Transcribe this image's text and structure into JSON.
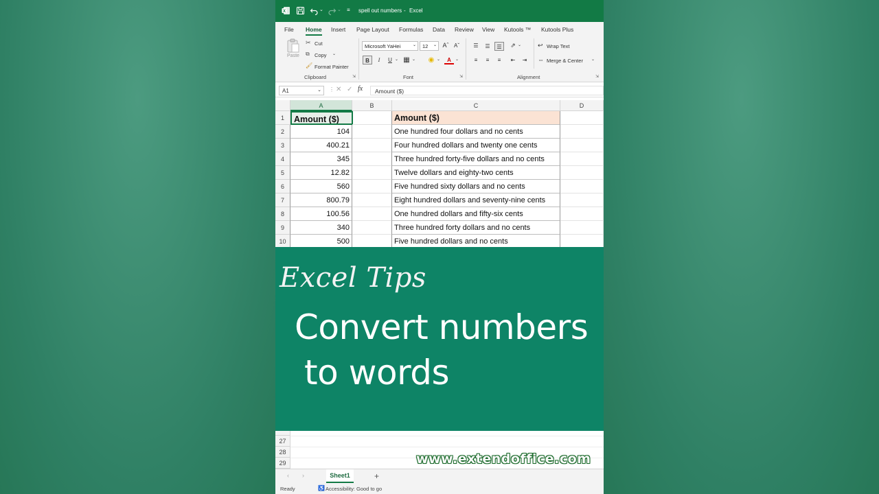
{
  "titlebar": {
    "doc_title": "spell out numbers",
    "app_name": "Excel",
    "separator": "-"
  },
  "menu": [
    "File",
    "Home",
    "Insert",
    "Page Layout",
    "Formulas",
    "Data",
    "Review",
    "View",
    "Kutools ™",
    "Kutools Plus"
  ],
  "ribbon": {
    "paste": "Paste",
    "cut": "Cut",
    "copy": "Copy",
    "format_painter": "Format Painter",
    "clipboard": "Clipboard",
    "font_name": "Microsoft YaHei",
    "font_size": "12",
    "font": "Font",
    "wrap_text": "Wrap Text",
    "merge_center": "Merge & Center",
    "alignment": "Alignment"
  },
  "formula_bar": {
    "name_box": "A1",
    "content": "Amount  ($)"
  },
  "grid": {
    "columns": [
      "A",
      "B",
      "C",
      "D"
    ],
    "rows": [
      "1",
      "2",
      "3",
      "4",
      "5",
      "6",
      "7",
      "8",
      "9",
      "10"
    ],
    "header_a": "Amount  ($)",
    "header_c": "Amount  ($)",
    "amounts": [
      "104",
      "400.21",
      "345",
      "12.82",
      "560",
      "800.79",
      "100.56",
      "340",
      "500"
    ],
    "words": [
      "One hundred four dollars and no cents",
      "Four hundred dollars and twenty one cents",
      "Three hundred forty-five dollars and no cents",
      "Twelve dollars and eighty-two cents",
      "Five hundred sixty dollars and no cents",
      "Eight hundred dollars and seventy-nine cents",
      "One hundred dollars and fifty-six cents",
      "Three hundred forty dollars and no cents",
      "Five hundred dollars and no cents"
    ]
  },
  "banner": {
    "tips": "Excel Tips",
    "line1": "Convert numbers",
    "line2": "to words"
  },
  "lower_rows": [
    "27",
    "28",
    "29"
  ],
  "watermark": "www.extendoffice.com",
  "sheet_tab": "Sheet1",
  "add_sheet": "+",
  "status": {
    "ready": "Ready",
    "accessibility": "Accessibility: Good to go"
  },
  "colors": {
    "excel_green": "#127a45",
    "banner": "#0e8466",
    "header_c_fill": "#fbe3d4"
  }
}
